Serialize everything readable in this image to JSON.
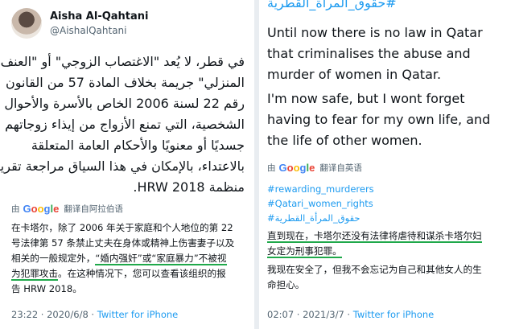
{
  "left_tweet": {
    "author_name": "Aisha Al-Qahtani",
    "author_handle": "@AishalQahtani",
    "arabic_lines": [
      "في قطر، لا يُعد \"الاغتصاب الزوجي\" أو \"العنف",
      "المنزلي\" جريمة بخلاف المادة 57 من القانون",
      "رقم 22 لسنة 2006 الخاص بالأسرة والأحوال",
      "الشخصية، التي تمنع الأزواج من إيذاء زوجاتهم",
      "جسديًا أو معنويًا والأحكام العامة المتعلقة",
      "بالاعتداء، بالإمكان في هذا السياق مراجعة تقرير",
      "منظمة HRW 2018."
    ],
    "translate_prefix": "由",
    "translate_label": "翻译自阿拉伯语",
    "translation_lines": [
      {
        "text": "在卡塔尔，除了 2006 年关于家庭和个人地位的第 22",
        "hl": ""
      },
      {
        "text": "号法律第 57 条禁止丈夫在身体或精神上伤害妻子以及",
        "hl": ""
      },
      {
        "text": "相关的一般规定外，",
        "hl": "“婚内强奸”或“家庭暴力”不被视",
        "after": ""
      },
      {
        "text": "",
        "hl": "为犯罪攻击",
        "after": "。在这种情况下，您可以查看该组织的报"
      },
      {
        "text": "告 HRW 2018。",
        "hl": ""
      }
    ],
    "time": "23:22 · 2020/6/8 · ",
    "source": "Twitter for iPhone"
  },
  "right_tweet": {
    "top_hashtag": "#حقوق_المرأة_القطرية",
    "paragraph_1": "Until now there is no law in Qatar that criminalises the abuse and murder of women in Qatar.",
    "paragraph_2": "I'm now safe, but I wont forget having to fear for my own life, and the life of other women.",
    "translate_prefix": "由",
    "translate_label": "翻译自英语",
    "hashtags": [
      "#rewarding_murderers",
      "#Qatari_women_rights",
      "#حقوق_المرأة_القطرية"
    ],
    "translation_line_1": "直到现在，卡塔尔还没有法律将虐待和谋杀卡塔尔妇",
    "translation_line_2": "女定为刑事犯罪。",
    "translation_line_3": "我现在安全了，但我不会忘记为自己和其他女人的生",
    "translation_line_4": "命担心。",
    "time": "02:07 · 2021/3/7 · ",
    "source": "Twitter for iPhone"
  },
  "google_logo": [
    "G",
    "o",
    "o",
    "g",
    "l",
    "e"
  ],
  "colors": {
    "link": "#1d9bf0",
    "muted": "#536471",
    "underline": "#1fa84a"
  }
}
